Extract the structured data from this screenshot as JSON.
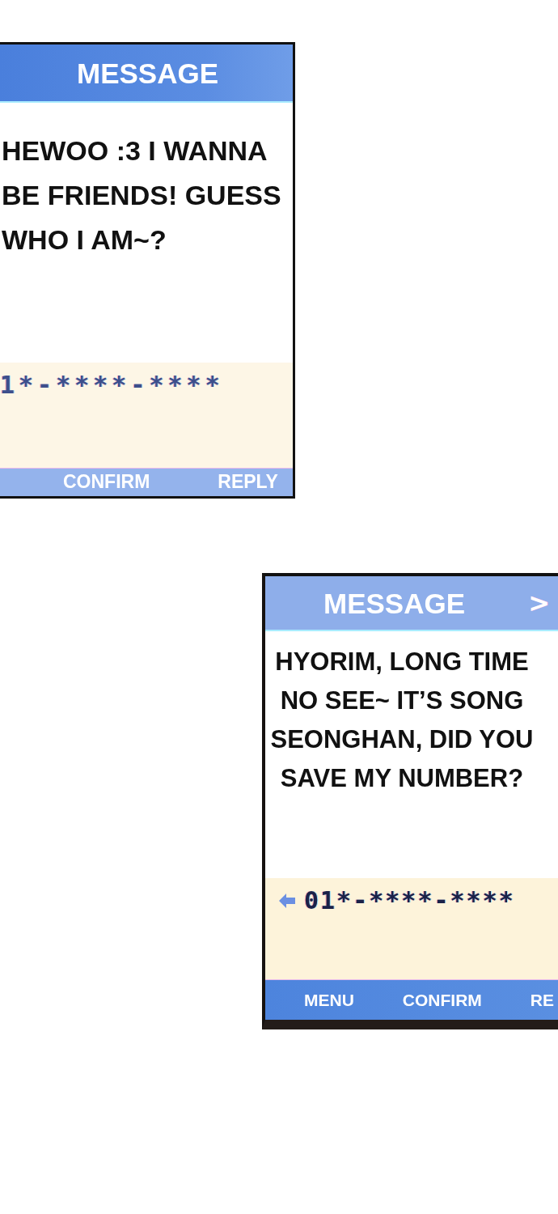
{
  "screens": [
    {
      "kind": "left",
      "title": "MESSAGE",
      "message_lines": [
        "HEWOO :3 I WANNA",
        "BE FRIENDS! GUESS",
        "WHO I AM~?"
      ],
      "sender_number": "1*-****-****",
      "softkeys": [
        "CONFIRM",
        "REPLY"
      ]
    },
    {
      "kind": "right",
      "title": "MESSAGE",
      "next_arrow": ">",
      "message_lines": [
        "HYORIM, LONG TIME",
        "NO SEE~ IT’S SONG",
        "SEONGHAN, DID YOU",
        "SAVE MY NUMBER?"
      ],
      "sender_number": "01*-****-****",
      "softkeys": [
        "MENU",
        "CONFIRM",
        "RE"
      ]
    }
  ]
}
